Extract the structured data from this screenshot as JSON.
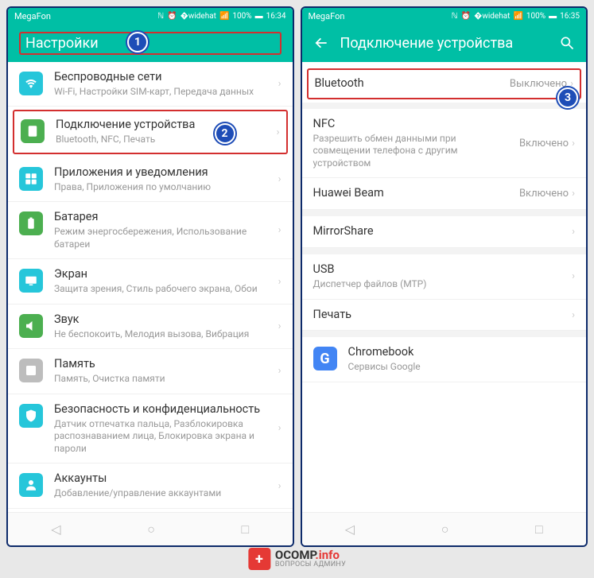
{
  "left": {
    "status": {
      "carrier": "MegaFon",
      "battery": "100%",
      "time": "16:34"
    },
    "title": "Настройки",
    "items": [
      {
        "title": "Беспроводные сети",
        "sub": "Wi-Fi, Настройки SIM-карт, Передача данных"
      },
      {
        "title": "Подключение устройства",
        "sub": "Bluetooth, NFC, Печать"
      },
      {
        "title": "Приложения и уведомления",
        "sub": "Права, Приложения по умолчанию"
      },
      {
        "title": "Батарея",
        "sub": "Режим энергосбережения, Использование батареи"
      },
      {
        "title": "Экран",
        "sub": "Защита зрения, Стиль рабочего экрана, Обои"
      },
      {
        "title": "Звук",
        "sub": "Не беспокоить, Мелодия вызова, Вибрация"
      },
      {
        "title": "Память",
        "sub": "Память, Очистка памяти"
      },
      {
        "title": "Безопасность и конфиденциальность",
        "sub": "Датчик отпечатка пальца, Разблокировка распознаванием лица, Блокировка экрана и пароли"
      },
      {
        "title": "Аккаунты",
        "sub": "Добавление/управление аккаунтами"
      }
    ]
  },
  "right": {
    "status": {
      "carrier": "MegaFon",
      "battery": "100%",
      "time": "16:35"
    },
    "title": "Подключение устройства",
    "items": [
      {
        "title": "Bluetooth",
        "value": "Выключено"
      },
      {
        "title": "NFC",
        "sub": "Разрешить обмен данными при совмещении телефона с другим устройством",
        "value": "Включено"
      },
      {
        "title": "Huawei Beam",
        "value": "Включено"
      },
      {
        "title": "MirrorShare"
      },
      {
        "title": "USB",
        "sub": "Диспетчер файлов (MTP)"
      },
      {
        "title": "Печать"
      },
      {
        "title": "Chromebook",
        "sub": "Сервисы Google",
        "icon": "G"
      }
    ]
  },
  "callouts": {
    "c1": "1",
    "c2": "2",
    "c3": "3"
  },
  "watermark": {
    "badge": "+",
    "main1": "OCOMP",
    "main2": ".info",
    "sub": "ВОПРОСЫ АДМИНУ"
  }
}
